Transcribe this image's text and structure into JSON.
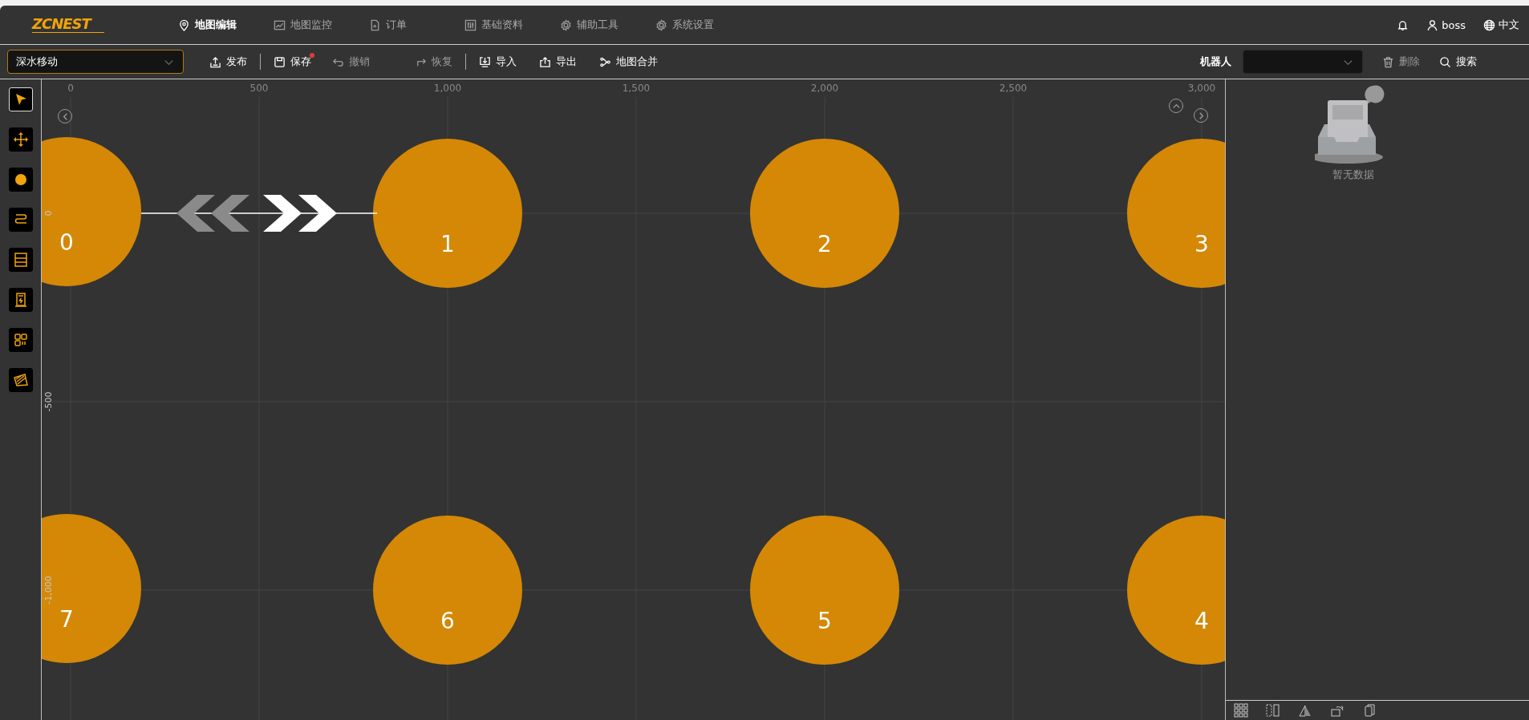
{
  "header": {
    "logo": "ZCNEST",
    "nav": [
      {
        "label": "地图编辑",
        "kind": "pin",
        "selected": true
      },
      {
        "label": "地图监控",
        "kind": "chart",
        "selected": false
      },
      {
        "label": "订单",
        "kind": "doc",
        "selected": false
      },
      {
        "label": "基础资料",
        "kind": "sliders",
        "selected": false
      },
      {
        "label": "辅助工具",
        "kind": "gear",
        "selected": false
      },
      {
        "label": "系统设置",
        "kind": "gear",
        "selected": false
      }
    ],
    "user": "boss",
    "language": "中文"
  },
  "toolbar": {
    "map_select": {
      "value": "深水移动"
    },
    "groups": [
      [
        {
          "label": "发布",
          "kind": "publish",
          "disabled": false,
          "modified": false
        }
      ],
      [
        {
          "label": "保存",
          "kind": "save",
          "disabled": false,
          "modified": true
        },
        {
          "label": "撤销",
          "kind": "undo",
          "disabled": true,
          "modified": false
        },
        {
          "label": "恢复",
          "kind": "redo",
          "disabled": true,
          "modified": false
        }
      ],
      [
        {
          "label": "导入",
          "kind": "import",
          "disabled": false,
          "modified": false
        },
        {
          "label": "导出",
          "kind": "export",
          "disabled": false,
          "modified": false
        },
        {
          "label": "地图合并",
          "kind": "merge",
          "disabled": false,
          "modified": false
        }
      ]
    ],
    "robot_label": "机器人",
    "right_actions": [
      {
        "label": "删除",
        "kind": "trash",
        "disabled": true
      },
      {
        "label": "搜索",
        "kind": "search",
        "disabled": false
      }
    ]
  },
  "tools": [
    {
      "kind": "select",
      "selected": true
    },
    {
      "kind": "move",
      "selected": false
    },
    {
      "kind": "point",
      "selected": false
    },
    {
      "kind": "path",
      "selected": false
    },
    {
      "kind": "shelf",
      "selected": false
    },
    {
      "kind": "charger",
      "selected": false
    },
    {
      "kind": "code",
      "selected": false
    },
    {
      "kind": "area",
      "selected": false
    }
  ],
  "canvas": {
    "x_ruler": [
      "0",
      "500",
      "1,000",
      "1,500",
      "2,000",
      "2,500",
      "3,000"
    ],
    "y_ruler": [
      "0",
      "-500",
      "-1,000"
    ],
    "nodes": [
      {
        "label": "0"
      },
      {
        "label": "1"
      },
      {
        "label": "2"
      },
      {
        "label": "3"
      },
      {
        "label": "7"
      },
      {
        "label": "6"
      },
      {
        "label": "5"
      },
      {
        "label": "4"
      }
    ]
  },
  "side_panel": {
    "empty_text": "暂无数据"
  }
}
